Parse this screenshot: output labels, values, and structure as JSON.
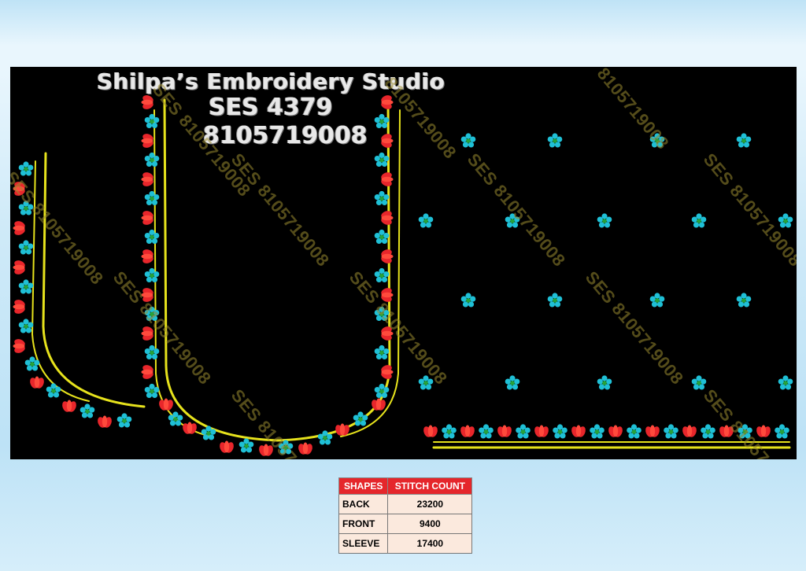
{
  "header": {
    "studio_name": "Shilpa’s Embroidery Studio",
    "design_code": "SES 4379",
    "phone": "8105719008"
  },
  "watermarks": [
    "8105719008",
    "8105719008",
    "SES 8105719008",
    "SES 8105719008",
    "SES 8105719008",
    "SES 8105719008",
    "SES 8105719008",
    "SES 8105719008",
    "SES 8105719008",
    "SES 8105719008",
    "SES 8105719008",
    "SES 8105719008"
  ],
  "colors": {
    "background": "#000000",
    "outline": "#e6e21c",
    "petal_red": "#e8262b",
    "flower_cyan": "#1fc0d6",
    "flower_center": "#26a23a"
  },
  "table": {
    "headers": [
      "SHAPES",
      "STITCH COUNT"
    ],
    "rows": [
      {
        "shape": "BACK",
        "count": "23200"
      },
      {
        "shape": "FRONT",
        "count": "9400"
      },
      {
        "shape": "SLEEVE",
        "count": "17400"
      }
    ]
  }
}
